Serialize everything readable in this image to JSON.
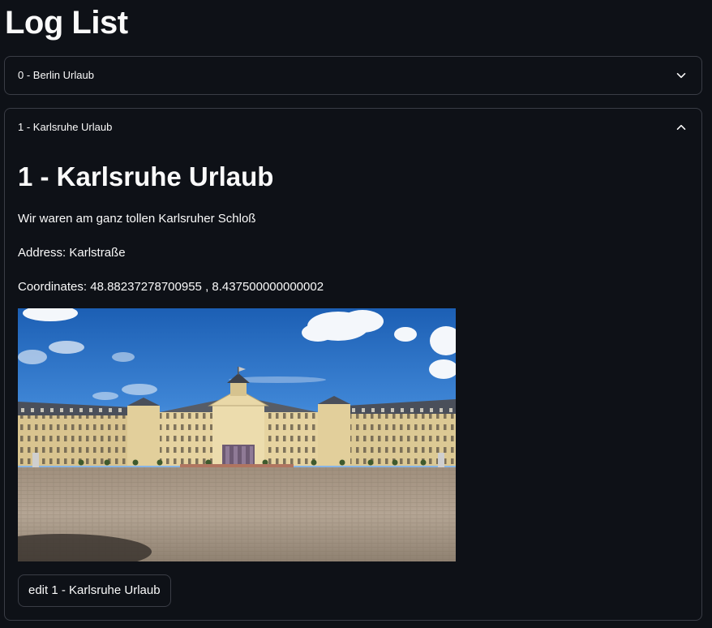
{
  "page": {
    "title": "Log List"
  },
  "expanders": [
    {
      "label": "0 - Berlin Urlaub",
      "expanded": false,
      "chevron_icon": "chevron-down-icon"
    },
    {
      "label": "1 - Karlsruhe Urlaub",
      "expanded": true,
      "chevron_icon": "chevron-up-icon",
      "content": {
        "heading": "1 - Karlsruhe Urlaub",
        "description": "Wir waren am ganz tollen Karlsruher Schloß",
        "address_label": "Address:",
        "address": "Karlstraße",
        "coordinates_label": "Coordinates:",
        "latitude": "48.88237278700955",
        "separator": ",",
        "longitude": "8.437500000000002",
        "image_subject": "Karlsruhe Palace photo",
        "edit_button": "edit 1 - Karlsruhe Urlaub"
      }
    }
  ],
  "colors": {
    "background": "#0e1117",
    "border": "#3a3d46",
    "text": "#fafafa"
  }
}
